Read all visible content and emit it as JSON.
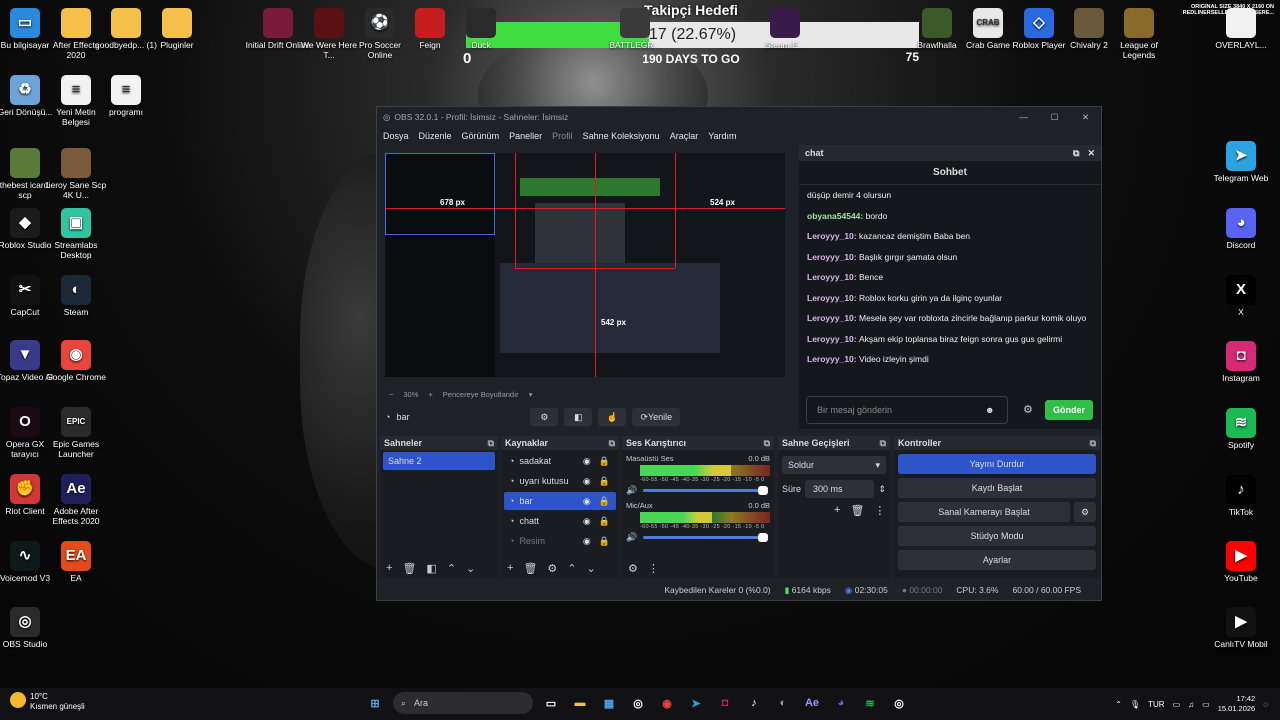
{
  "desktop_left": [
    {
      "label": "Bu bilgisayar",
      "icon": "computer-icon",
      "color": "#2a8ae0",
      "glyph": "▭"
    },
    {
      "label": "After Effects 2020",
      "icon": "folder-icon",
      "color": "#f4c04a",
      "glyph": ""
    },
    {
      "label": "goodbyedp... (1)",
      "icon": "folder-icon",
      "color": "#f4c04a",
      "glyph": ""
    },
    {
      "label": "Pluginler",
      "icon": "folder-icon",
      "color": "#f4c04a",
      "glyph": ""
    },
    {
      "label": "Geri Dönüşü...",
      "icon": "recycle-bin-icon",
      "color": "#6aa4d8",
      "glyph": "♻"
    },
    {
      "label": "Yeni Metin Belgesi",
      "icon": "text-file-icon",
      "color": "#f2f2f2",
      "glyph": "≡"
    },
    {
      "label": "programı",
      "icon": "text-file-icon",
      "color": "#f2f2f2",
      "glyph": "≡"
    },
    {
      "label": "thebest icardi scp",
      "icon": "image-file-icon",
      "color": "#5a7a3a",
      "glyph": ""
    },
    {
      "label": "Leroy Sane Scp 4K U...",
      "icon": "image-file-icon",
      "color": "#7a5a3a",
      "glyph": ""
    },
    {
      "label": "Roblox Studio",
      "icon": "roblox-studio-icon",
      "color": "#1c1c1c",
      "glyph": "◆"
    },
    {
      "label": "Streamlabs Desktop",
      "icon": "streamlabs-icon",
      "color": "#31c3a2",
      "glyph": "▣"
    },
    {
      "label": "CapCut",
      "icon": "capcut-icon",
      "color": "#111111",
      "glyph": "✂"
    },
    {
      "label": "Steam",
      "icon": "steam-icon",
      "color": "#1b2838",
      "glyph": "◐"
    },
    {
      "label": "Topaz Video AI",
      "icon": "topaz-icon",
      "color": "#3a3a8a",
      "glyph": "▼"
    },
    {
      "label": "Google Chrome",
      "icon": "chrome-icon",
      "color": "#e8453c",
      "glyph": "◉"
    },
    {
      "label": "Opera GX tarayıcı",
      "icon": "opera-gx-icon",
      "color": "#1a0a14",
      "glyph": "O"
    },
    {
      "label": "Epic Games Launcher",
      "icon": "epic-games-icon",
      "color": "#2a2a2a",
      "glyph": "EPIC"
    },
    {
      "label": "Riot Client",
      "icon": "riot-client-icon",
      "color": "#d13639",
      "glyph": "✊"
    },
    {
      "label": "Adobe After Effects 2020",
      "icon": "after-effects-icon",
      "color": "#1f1f5c",
      "glyph": "Ae"
    },
    {
      "label": "Voicemod V3",
      "icon": "voicemod-icon",
      "color": "#0c1a1a",
      "glyph": "∿"
    },
    {
      "label": "EA",
      "icon": "ea-icon",
      "color": "#e34b1d",
      "glyph": "EA"
    },
    {
      "label": "OBS Studio",
      "icon": "obs-icon",
      "color": "#2a2a2a",
      "glyph": "◎"
    }
  ],
  "desktop_top": [
    {
      "label": "Initial Drift Online",
      "icon": "initial-drift-icon",
      "color": "#7a1a3a",
      "glyph": ""
    },
    {
      "label": "We Were Here T...",
      "icon": "we-were-here-icon",
      "color": "#5a1010",
      "glyph": ""
    },
    {
      "label": "Pro Soccer Online",
      "icon": "pro-soccer-icon",
      "color": "#2a2a2a",
      "glyph": "⚽"
    },
    {
      "label": "Feign",
      "icon": "feign-icon",
      "color": "#c41e1e",
      "glyph": ""
    },
    {
      "label": "Duck",
      "icon": "duck-icon",
      "color": "#2a2a2a",
      "glyph": ""
    },
    {
      "label": "BATTLEGR...",
      "icon": "battlegrounds-icon",
      "color": "#3a3a3a",
      "glyph": ""
    },
    {
      "label": "Steam E...",
      "icon": "steam-app-icon",
      "color": "#3a1a4a",
      "glyph": ""
    },
    {
      "label": "Brawlhalla",
      "icon": "brawlhalla-icon",
      "color": "#3a5a2a",
      "glyph": ""
    },
    {
      "label": "Crab Game",
      "icon": "crab-game-icon",
      "color": "#e8e8e8",
      "glyph": "CRAB"
    },
    {
      "label": "Roblox Player",
      "icon": "roblox-player-icon",
      "color": "#2a6ae0",
      "glyph": "◇"
    },
    {
      "label": "Chivalry 2",
      "icon": "chivalry-icon",
      "color": "#6a5a3a",
      "glyph": ""
    },
    {
      "label": "League of Legends",
      "icon": "league-of-legends-icon",
      "color": "#8a6a2a",
      "glyph": ""
    },
    {
      "label": "OVERLAYL...",
      "icon": "overlay-file-icon",
      "color": "#f2f2f2",
      "glyph": ""
    }
  ],
  "desktop_right": [
    {
      "label": "Telegram Web",
      "icon": "telegram-icon",
      "color": "#2aa3e0",
      "glyph": "➤"
    },
    {
      "label": "Discord",
      "icon": "discord-icon",
      "color": "#5865f2",
      "glyph": "◕"
    },
    {
      "label": "X",
      "icon": "x-icon",
      "color": "#000000",
      "glyph": "X"
    },
    {
      "label": "Instagram",
      "icon": "instagram-icon",
      "color": "#d62976",
      "glyph": "◘"
    },
    {
      "label": "Spotify",
      "icon": "spotify-icon",
      "color": "#1db954",
      "glyph": "≋"
    },
    {
      "label": "TikTok",
      "icon": "tiktok-icon",
      "color": "#000000",
      "glyph": "♪"
    },
    {
      "label": "YouTube",
      "icon": "youtube-icon",
      "color": "#ff0000",
      "glyph": "▶"
    },
    {
      "label": "CanlıTV Mobil",
      "icon": "canlitv-icon",
      "color": "#111111",
      "glyph": "▶"
    }
  ],
  "goal": {
    "title": "Takipçi Hedefi",
    "value_text": "17 (22.67%)",
    "progress": 0.2267,
    "min": "0",
    "max": "75",
    "days": "190 DAYS TO GO",
    "color": "#3fdd3f"
  },
  "corner_note": "ORIGINAL SIZE 3840 X 2160 ON REDLINERSELLER · DEAD SERE...",
  "obs": {
    "title": "OBS 32.0.1 - Profil: İsimsiz - Sahneler: İsimsiz",
    "menu": [
      "Dosya",
      "Düzenle",
      "Görünüm",
      "Paneller",
      "Profil",
      "Sahne Koleksiyonu",
      "Araçlar",
      "Yardım"
    ],
    "preview_labels": {
      "a": "678 px",
      "b": "524 px",
      "c": "542 px"
    },
    "zoom": "30%",
    "zoom_mode": "Pencereye Boyutlandır",
    "current_source": "bar",
    "refresh": "Yenile",
    "chat": {
      "dock_title": "chat",
      "header": "Sohbet",
      "messages": [
        {
          "user": "",
          "text": "düşüp demir 4 olursun",
          "color": "#d7b7e8"
        },
        {
          "user": "obyana54544:",
          "text": "bordo",
          "color": "#9ee2a0"
        },
        {
          "user": "Leroyyy_10:",
          "text": "kazancaz demiştim Baba ben",
          "color": "#d7b7e8"
        },
        {
          "user": "Leroyyy_10:",
          "text": "Başlık gırgır şamata olsun",
          "color": "#d7b7e8"
        },
        {
          "user": "Leroyyy_10:",
          "text": "Bence",
          "color": "#d7b7e8"
        },
        {
          "user": "Leroyyy_10:",
          "text": "Roblox korku girin ya da ilginç oyunlar",
          "color": "#d7b7e8"
        },
        {
          "user": "Leroyyy_10:",
          "text": "Mesela şey var robloxta zincirle bağlanıp parkur komik oluyo",
          "color": "#d7b7e8"
        },
        {
          "user": "Leroyyy_10:",
          "text": "Akşam ekip toplansa biraz feign sonra gus gus gelirmi",
          "color": "#d7b7e8"
        },
        {
          "user": "Leroyyy_10:",
          "text": "Video izleyin şimdi",
          "color": "#d7b7e8"
        }
      ],
      "input_placeholder": "Bir mesaj gönderin",
      "send": "Gönder"
    },
    "scenes": {
      "title": "Sahneler",
      "items": [
        "Sahne 2"
      ]
    },
    "sources": {
      "title": "Kaynaklar",
      "items": [
        "sadakat",
        "uyarı kutusu",
        "bar",
        "chatt",
        "Resim"
      ],
      "selected": "bar"
    },
    "mixer": {
      "title": "Ses Karıştırıcı",
      "channels": [
        {
          "name": "Masaüstü Ses",
          "db": "0.0 dB",
          "level": 0.7
        },
        {
          "name": "Mic/Aux",
          "db": "0.0 dB",
          "level": 0.55
        }
      ],
      "scale": "-60-55 -50 -45 -40-35 -30 -25 -20 -15 -10 -5 0"
    },
    "transitions": {
      "title": "Sahne Geçişleri",
      "type": "Soldur",
      "duration_label": "Süre",
      "duration": "300 ms"
    },
    "controls": {
      "title": "Kontroller",
      "buttons": [
        "Yayını Durdur",
        "Kaydı Başlat",
        "Sanal Kamerayı Başlat",
        "Stüdyo Modu",
        "Ayarlar"
      ]
    },
    "status": {
      "dropped": "Kaybedilen Kareler 0 (%0.0)",
      "bitrate": "6164 kbps",
      "stream_time": "02:30:05",
      "rec_time": "00:00:00",
      "cpu": "CPU: 3.6%",
      "fps": "60.00 / 60.00 FPS"
    }
  },
  "taskbar": {
    "weather_temp": "10°C",
    "weather_desc": "Kısmen güneşli",
    "search_placeholder": "Ara",
    "lang": "TUR",
    "time": "17:42",
    "date": "15.01.2026"
  }
}
